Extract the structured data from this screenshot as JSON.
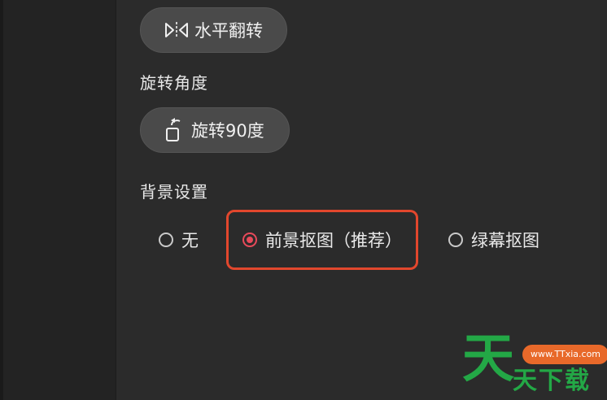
{
  "flip": {
    "label": "水平翻转",
    "icon": "flip-horizontal-icon"
  },
  "rotation": {
    "section_label": "旋转角度",
    "button_label": "旋转90度",
    "icon": "rotate-icon"
  },
  "background": {
    "section_label": "背景设置",
    "options": [
      {
        "label": "无",
        "selected": false
      },
      {
        "label": "前景抠图（推荐）",
        "selected": true
      },
      {
        "label": "绿幕抠图",
        "selected": false
      }
    ]
  },
  "colors": {
    "panel_bg": "#2b2b2b",
    "button_bg": "#4a4a4a",
    "radio_selected": "#e84a5a",
    "highlight": "#e2472d",
    "watermark_green": "#23a846",
    "watermark_orange": "#e8692a"
  },
  "watermark": {
    "big_char": "天",
    "url": "www.TTxia.com",
    "text": "天下载"
  }
}
